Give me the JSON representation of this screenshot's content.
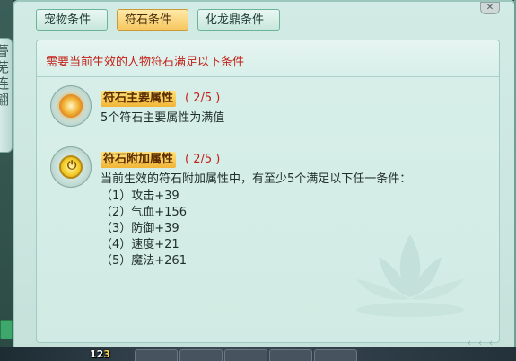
{
  "left_scroll": {
    "text": "瞢芜连翩"
  },
  "tabs": [
    {
      "label": "宠物条件",
      "active": false
    },
    {
      "label": "符石条件",
      "active": true
    },
    {
      "label": "化龙鼎条件",
      "active": false
    }
  ],
  "close_icon": "close-icon",
  "panel": {
    "title": "需要当前生效的人物符石满足以下条件",
    "requirements": [
      {
        "icon": "fire-rune-icon",
        "title": "符石主要属性",
        "count": "( 2/5 )",
        "description": "5个符石主要属性为满值"
      },
      {
        "icon": "gold-rune-icon",
        "title": "符石附加属性",
        "count": "( 2/5 )",
        "description": "当前生效的符石附加属性中，有至少5个满足以下任一条件：",
        "conditions": [
          "（1）攻击+39",
          "（2）气血+156",
          "（3）防御+39",
          "（4）速度+21",
          "（5）魔法+261"
        ]
      }
    ]
  },
  "bottom_bar": {
    "number_white": "12",
    "number_yellow": "3"
  },
  "colors": {
    "accent_red": "#c3221a",
    "active_tab": "#f6c760",
    "panel_bg": "#d1ebe4"
  }
}
